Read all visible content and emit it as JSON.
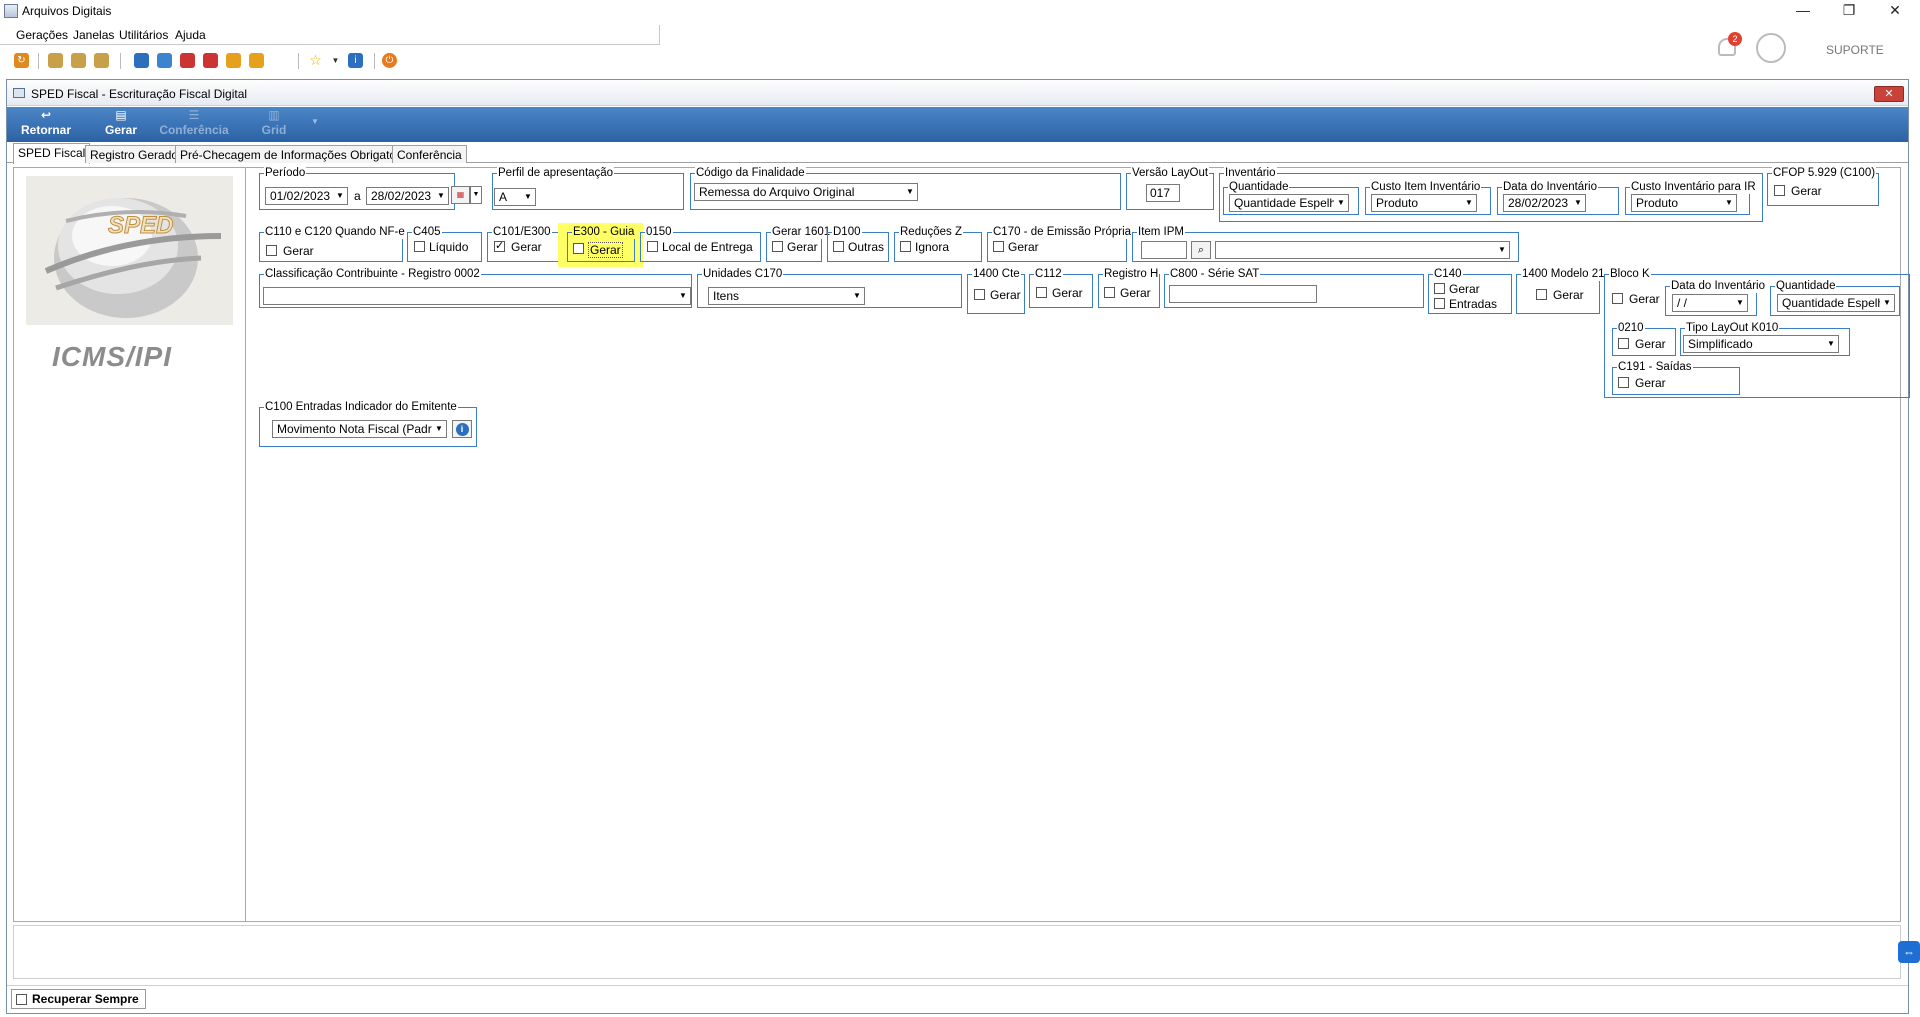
{
  "app": {
    "title": "Arquivos Digitais",
    "support_label": "SUPORTE",
    "notification_count": "2"
  },
  "window_controls": {
    "minimize": "—",
    "restore": "❐",
    "close": "✕"
  },
  "menu": [
    "Gerações",
    "Janelas",
    "Utilitários",
    "Ajuda"
  ],
  "inner": {
    "title": "SPED Fiscal - Escrituração Fiscal Digital",
    "close_label": "✕",
    "ribbon": {
      "retornar": "Retornar",
      "gerar": "Gerar",
      "conferencia": "Conferência",
      "grid": "Grid"
    },
    "tabs": [
      "SPED Fiscal",
      "Registro Gerado",
      "Pré-Checagem de Informações Obrigatórias",
      "Conferência"
    ]
  },
  "logo": {
    "sped_text": "SPED",
    "caption": "ICMS/IPI"
  },
  "form": {
    "periodo": {
      "label": "Período",
      "from": "01/02/2023",
      "sep": "a",
      "to": "28/02/2023"
    },
    "perfil": {
      "label": "Perfil de apresentação",
      "value": "A"
    },
    "finalidade": {
      "label": "Código da Finalidade",
      "value": "Remessa do Arquivo Original"
    },
    "versao": {
      "label": "Versão LayOut",
      "value": "017"
    },
    "inventario": {
      "label": "Inventário",
      "quantidade_label": "Quantidade",
      "quantidade_value": "Quantidade Espelho",
      "custo_label": "Custo Item Inventário",
      "custo_value": "Produto",
      "data_label": "Data do Inventário",
      "data_value": "28/02/2023",
      "custo_ir_label": "Custo Inventário para IR",
      "custo_ir_value": "Produto"
    },
    "cfop": {
      "label": "CFOP 5.929 (C100)",
      "check": "Gerar"
    },
    "c110": {
      "label": "C110 e C120 Quando NF-e",
      "check": "Gerar"
    },
    "c405": {
      "label": "C405",
      "check": "Líquido"
    },
    "c101": {
      "label": "C101/E300",
      "check": "Gerar"
    },
    "e300": {
      "label": "E300 - Guia",
      "check": "Gerar"
    },
    "r0150": {
      "label": "0150",
      "check": "Local de Entrega"
    },
    "g1601": {
      "label": "Gerar 1601",
      "check": "Gerar"
    },
    "d100": {
      "label": "D100",
      "check": "Outras"
    },
    "reducoes": {
      "label": "Reduções Z",
      "check": "Ignora"
    },
    "c170e": {
      "label": "C170 - de Emissão Própria",
      "check": "Gerar"
    },
    "item_ipm": {
      "label": "Item IPM"
    },
    "classificacao": {
      "label": "Classificação Contribuinte - Registro 0002",
      "value": ""
    },
    "unidades": {
      "label": "Unidades C170",
      "value": "Itens"
    },
    "r1400cte": {
      "label": "1400 Cte",
      "check": "Gerar"
    },
    "c112": {
      "label": "C112",
      "check": "Gerar"
    },
    "registro_h": {
      "label": "Registro H",
      "check": "Gerar"
    },
    "c800": {
      "label": "C800 - Série SAT",
      "value": ""
    },
    "c140": {
      "label": "C140",
      "check1": "Gerar",
      "check2": "Entradas"
    },
    "r1400m21": {
      "label": "1400 Modelo 21",
      "check": "Gerar"
    },
    "bloco_k": {
      "label": "Bloco K",
      "check": "Gerar",
      "data_label": "Data do Inventário",
      "data_value": "/ /",
      "quantidade_label": "Quantidade",
      "quantidade_value": "Quantidade Espelho",
      "r0210_label": "0210",
      "r0210_check": "Gerar",
      "k010_label": "Tipo LayOut K010",
      "k010_value": "Simplificado",
      "c191_label": "C191 - Saídas",
      "c191_check": "Gerar"
    },
    "c100_entradas": {
      "label": "C100 Entradas Indicador do Emitente",
      "value": "Movimento Nota Fiscal (Padrão)"
    }
  },
  "status": {
    "recuperar": "Recuperar Sempre"
  },
  "colors": {
    "ribbon": "#2c62a5",
    "group_border": "#3a7ec8",
    "highlight": "#ffff66"
  }
}
